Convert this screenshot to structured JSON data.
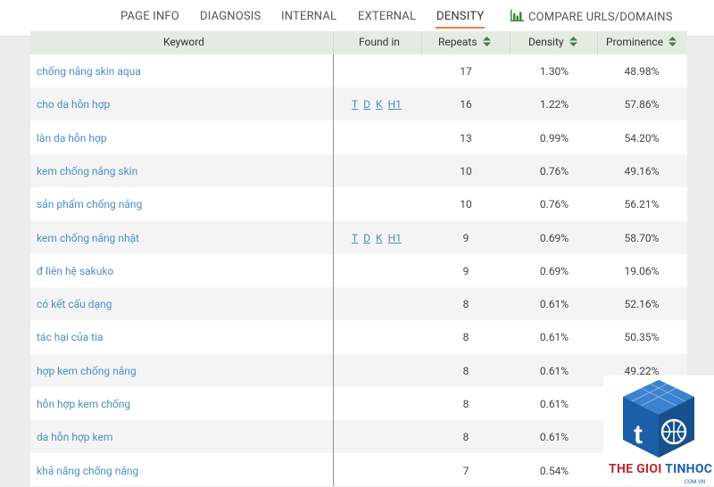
{
  "nav": {
    "tabs": [
      {
        "id": "page-info",
        "label": "PAGE INFO"
      },
      {
        "id": "diagnosis",
        "label": "DIAGNOSIS"
      },
      {
        "id": "internal",
        "label": "INTERNAL"
      },
      {
        "id": "external",
        "label": "EXTERNAL"
      },
      {
        "id": "density",
        "label": "DENSITY",
        "active": true
      },
      {
        "id": "compare",
        "label": "COMPARE URLS/DOMAINS",
        "icon": "bar-chart-icon"
      }
    ],
    "accent_color": "#f08040"
  },
  "table": {
    "headers": {
      "keyword": "Keyword",
      "found_in": "Found in",
      "repeats": "Repeats",
      "density": "Density",
      "prominence": "Prominence"
    },
    "rows": [
      {
        "keyword": "chống nắng skin aqua",
        "found_in": [],
        "repeats": "17",
        "density": "1.30%",
        "prominence": "48.98%"
      },
      {
        "keyword": "cho da hỗn hợp",
        "found_in": [
          "T",
          "D",
          "K",
          "H1"
        ],
        "repeats": "16",
        "density": "1.22%",
        "prominence": "57.86%"
      },
      {
        "keyword": "làn da hỗn hợp",
        "found_in": [],
        "repeats": "13",
        "density": "0.99%",
        "prominence": "54.20%"
      },
      {
        "keyword": "kem chống nắng skin",
        "found_in": [],
        "repeats": "10",
        "density": "0.76%",
        "prominence": "49.16%"
      },
      {
        "keyword": "sản phẩm chống nắng",
        "found_in": [],
        "repeats": "10",
        "density": "0.76%",
        "prominence": "56.21%"
      },
      {
        "keyword": "kem chống nắng nhật",
        "found_in": [
          "T",
          "D",
          "K",
          "H1"
        ],
        "repeats": "9",
        "density": "0.69%",
        "prominence": "58.70%"
      },
      {
        "keyword": "đ liên hệ sakuko",
        "found_in": [],
        "repeats": "9",
        "density": "0.69%",
        "prominence": "19.06%"
      },
      {
        "keyword": "có kết cấu dạng",
        "found_in": [],
        "repeats": "8",
        "density": "0.61%",
        "prominence": "52.16%"
      },
      {
        "keyword": "tác hại của tia",
        "found_in": [],
        "repeats": "8",
        "density": "0.61%",
        "prominence": "50.35%"
      },
      {
        "keyword": "hợp kem chống nắng",
        "found_in": [],
        "repeats": "8",
        "density": "0.61%",
        "prominence": "49.22%"
      },
      {
        "keyword": "hỗn hợp kem chống",
        "found_in": [],
        "repeats": "8",
        "density": "0.61%",
        "prominence": ""
      },
      {
        "keyword": "da hỗn hợp kem",
        "found_in": [],
        "repeats": "8",
        "density": "0.61%",
        "prominence": ""
      },
      {
        "keyword": "khả năng chống nắng",
        "found_in": [],
        "repeats": "7",
        "density": "0.54%",
        "prominence": ""
      }
    ]
  },
  "watermark": {
    "brand_part1": "THE GIOI ",
    "brand_part2": "TINHOC",
    "domain": ".COM.VN",
    "icon": "tgth-logo-icon",
    "colors": {
      "red": "#c1272d",
      "blue": "#1b5fa8"
    }
  }
}
